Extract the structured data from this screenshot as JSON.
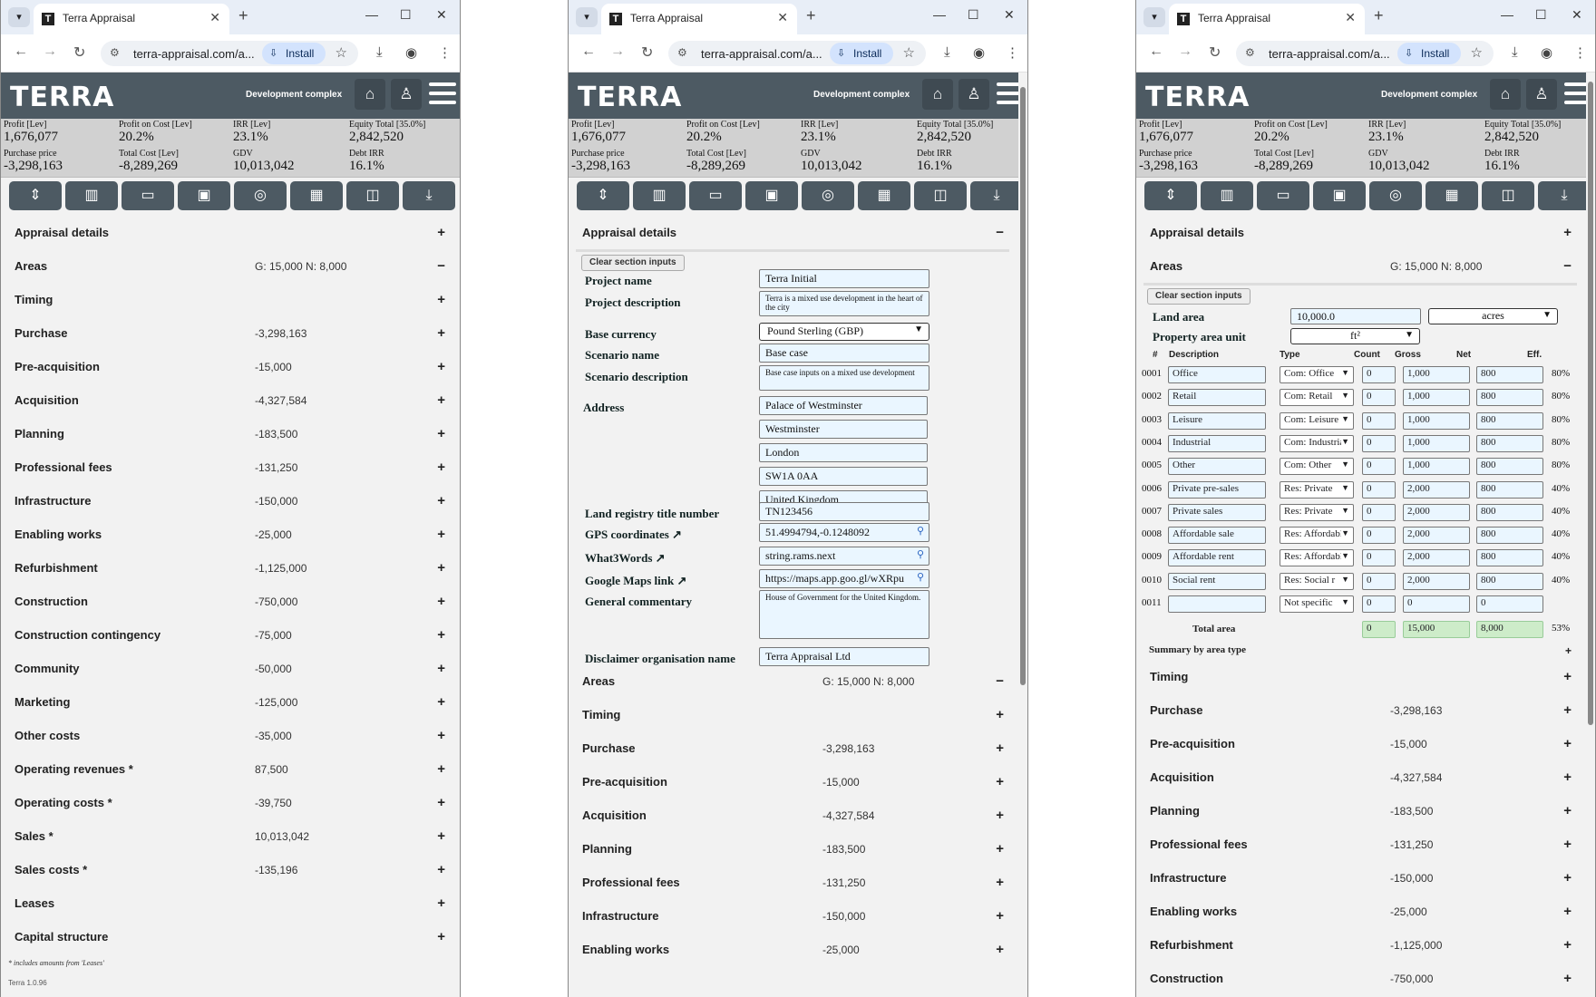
{
  "browser": {
    "tab_title": "Terra Appraisal",
    "favicon_letter": "T",
    "url": "terra-appraisal.com/a...",
    "install_label": "Install"
  },
  "app": {
    "logo": "TERRA",
    "project_type": "Development complex",
    "version": "Terra 1.0.96",
    "footnote": "* includes amounts from 'Leases'"
  },
  "metrics": [
    {
      "label": "Profit [Lev]",
      "value": "1,676,077"
    },
    {
      "label": "Profit on Cost [Lev]",
      "value": "20.2%"
    },
    {
      "label": "IRR [Lev]",
      "value": "23.1%"
    },
    {
      "label": "Equity Total [35.0%]",
      "value": "2,842,520"
    },
    {
      "label": "Purchase price",
      "value": "-3,298,163"
    },
    {
      "label": "Total Cost [Lev]",
      "value": "-8,289,269"
    },
    {
      "label": "GDV",
      "value": "10,013,042"
    },
    {
      "label": "Debt IRR",
      "value": "16.1%"
    }
  ],
  "sections": [
    {
      "name": "Appraisal details",
      "value": "",
      "sign": "+"
    },
    {
      "name": "Areas",
      "value": "G: 15,000   N: 8,000",
      "sign": "−"
    },
    {
      "name": "Timing",
      "value": "",
      "sign": "+"
    },
    {
      "name": "Purchase",
      "value": "-3,298,163",
      "sign": "+"
    },
    {
      "name": "Pre-acquisition",
      "value": "-15,000",
      "sign": "+"
    },
    {
      "name": "Acquisition",
      "value": "-4,327,584",
      "sign": "+"
    },
    {
      "name": "Planning",
      "value": "-183,500",
      "sign": "+"
    },
    {
      "name": "Professional fees",
      "value": "-131,250",
      "sign": "+"
    },
    {
      "name": "Infrastructure",
      "value": "-150,000",
      "sign": "+"
    },
    {
      "name": "Enabling works",
      "value": "-25,000",
      "sign": "+"
    },
    {
      "name": "Refurbishment",
      "value": "-1,125,000",
      "sign": "+"
    },
    {
      "name": "Construction",
      "value": "-750,000",
      "sign": "+"
    },
    {
      "name": "Construction contingency",
      "value": "-75,000",
      "sign": "+"
    },
    {
      "name": "Community",
      "value": "-50,000",
      "sign": "+"
    },
    {
      "name": "Marketing",
      "value": "-125,000",
      "sign": "+"
    },
    {
      "name": "Other costs",
      "value": "-35,000",
      "sign": "+"
    },
    {
      "name": "Operating revenues  *",
      "value": "87,500",
      "sign": "+"
    },
    {
      "name": "Operating costs  *",
      "value": "-39,750",
      "sign": "+"
    },
    {
      "name": "Sales  *",
      "value": "10,013,042",
      "sign": "+"
    },
    {
      "name": "Sales costs  *",
      "value": "-135,196",
      "sign": "+"
    },
    {
      "name": "Leases",
      "value": "",
      "sign": "+"
    },
    {
      "name": "Capital structure",
      "value": "",
      "sign": "+"
    }
  ],
  "details_form": {
    "section_title": "Appraisal details",
    "collapse_sign": "−",
    "clear_label": "Clear section inputs",
    "project_name_label": "Project name",
    "project_name": "Terra Initial",
    "project_description_label": "Project description",
    "project_description": "Terra is a mixed use development in the heart of the city",
    "base_currency_label": "Base currency",
    "base_currency": "Pound Sterling (GBP)",
    "scenario_name_label": "Scenario name",
    "scenario_name": "Base case",
    "scenario_description_label": "Scenario description",
    "scenario_description": "Base case inputs on a mixed use development",
    "address_label": "Address",
    "address": [
      "Palace of Westminster",
      "Westminster",
      "London",
      "SW1A 0AA",
      "United Kingdom"
    ],
    "land_registry_label": "Land registry title number",
    "land_registry": "TN123456",
    "gps_label": "GPS coordinates ↗",
    "gps": "51.4994794,-0.1248092",
    "w3w_label": "What3Words ↗",
    "w3w": "string.rams.next",
    "gmaps_label": "Google Maps link ↗",
    "gmaps": "https://maps.app.goo.gl/wXRpu",
    "commentary_label": "General commentary",
    "commentary": "House of Government for the United Kingdom.",
    "disclaimer_label": "Disclaimer organisation name",
    "disclaimer": "Terra Appraisal Ltd"
  },
  "areas_form": {
    "clear_label": "Clear section inputs",
    "land_area_label": "Land area",
    "land_area": "10,000.0",
    "land_unit": "acres",
    "property_unit_label": "Property area unit",
    "property_unit": "ft²",
    "headers": [
      "#",
      "Description",
      "Type",
      "Count",
      "Gross",
      "Net",
      "Eff."
    ],
    "rows": [
      {
        "num": "0001",
        "desc": "Office",
        "type": "Com: Office",
        "count": "0",
        "gross": "1,000",
        "net": "800",
        "eff": "80%"
      },
      {
        "num": "0002",
        "desc": "Retail",
        "type": "Com: Retail",
        "count": "0",
        "gross": "1,000",
        "net": "800",
        "eff": "80%"
      },
      {
        "num": "0003",
        "desc": "Leisure",
        "type": "Com: Leisure",
        "count": "0",
        "gross": "1,000",
        "net": "800",
        "eff": "80%"
      },
      {
        "num": "0004",
        "desc": "Industrial",
        "type": "Com: Industrial",
        "count": "0",
        "gross": "1,000",
        "net": "800",
        "eff": "80%"
      },
      {
        "num": "0005",
        "desc": "Other",
        "type": "Com: Other",
        "count": "0",
        "gross": "1,000",
        "net": "800",
        "eff": "80%"
      },
      {
        "num": "0006",
        "desc": "Private pre-sales",
        "type": "Res: Private",
        "count": "0",
        "gross": "2,000",
        "net": "800",
        "eff": "40%"
      },
      {
        "num": "0007",
        "desc": "Private sales",
        "type": "Res: Private",
        "count": "0",
        "gross": "2,000",
        "net": "800",
        "eff": "40%"
      },
      {
        "num": "0008",
        "desc": "Affordable sale",
        "type": "Res: Affordable",
        "count": "0",
        "gross": "2,000",
        "net": "800",
        "eff": "40%"
      },
      {
        "num": "0009",
        "desc": "Affordable rent",
        "type": "Res: Affordable",
        "count": "0",
        "gross": "2,000",
        "net": "800",
        "eff": "40%"
      },
      {
        "num": "0010",
        "desc": "Social rent",
        "type": "Res: Social r",
        "count": "0",
        "gross": "2,000",
        "net": "800",
        "eff": "40%"
      },
      {
        "num": "0011",
        "desc": "",
        "type": "Not specific",
        "count": "0",
        "gross": "0",
        "net": "0",
        "eff": ""
      }
    ],
    "total_label": "Total area",
    "total_count": "0",
    "total_gross": "15,000",
    "total_net": "8,000",
    "total_eff": "53%",
    "summary_label": "Summary by area type",
    "summary_sign": "+"
  }
}
